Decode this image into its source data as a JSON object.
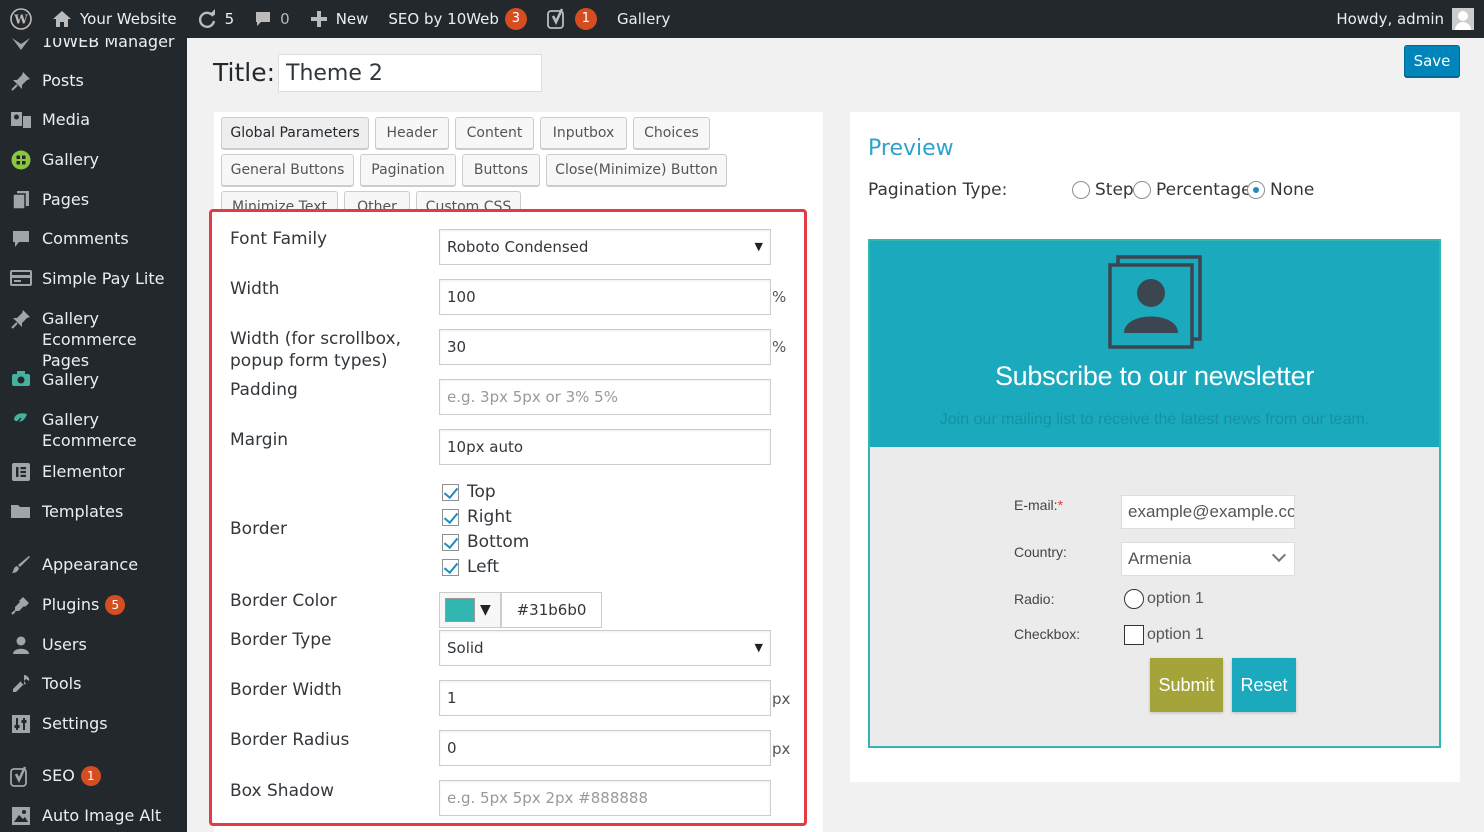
{
  "adminbar": {
    "site_name": "Your Website",
    "updates_count": "5",
    "comments_count": "0",
    "new_label": "New",
    "seo_label": "SEO by 10Web",
    "seo_count": "3",
    "yoast_count": "1",
    "gallery_label": "Gallery",
    "howdy": "Howdy, admin",
    "icons": [
      "wordpress-logo-icon",
      "home-icon",
      "refresh-icon",
      "comment-icon",
      "plus-icon",
      "yoast-icon"
    ]
  },
  "sidebar": {
    "items": [
      {
        "label": "10WEB Manager",
        "icon": "10web-icon"
      },
      {
        "label": "Posts",
        "icon": "pin-icon"
      },
      {
        "label": "Media",
        "icon": "media-icon"
      },
      {
        "label": "Gallery",
        "icon": "gallery-icon"
      },
      {
        "label": "Pages",
        "icon": "page-icon"
      },
      {
        "label": "Comments",
        "icon": "comment-icon"
      },
      {
        "label": "Simple Pay Lite",
        "icon": "pay-icon"
      },
      {
        "label": "Gallery Ecommerce Pages",
        "icon": "pin-icon"
      },
      {
        "label": "Gallery",
        "icon": "camera-icon"
      },
      {
        "label": "Gallery Ecommerce",
        "icon": "ecommerce-icon"
      },
      {
        "label": "Elementor",
        "icon": "elementor-icon"
      },
      {
        "label": "Templates",
        "icon": "folder-icon"
      },
      {
        "label": "Appearance",
        "icon": "brush-icon"
      },
      {
        "label": "Plugins",
        "icon": "plugin-icon",
        "badge": "5"
      },
      {
        "label": "Users",
        "icon": "user-icon"
      },
      {
        "label": "Tools",
        "icon": "wrench-icon"
      },
      {
        "label": "Settings",
        "icon": "settings-icon"
      },
      {
        "label": "SEO",
        "icon": "yoast-icon",
        "badge": "1"
      },
      {
        "label": "Auto Image Alt",
        "icon": "image-alt-icon"
      }
    ]
  },
  "title": {
    "label": "Title:",
    "value": "Theme 2",
    "save_label": "Save"
  },
  "tabs": [
    "Global Parameters",
    "Header",
    "Content",
    "Inputbox",
    "Choices",
    "General Buttons",
    "Pagination",
    "Buttons",
    "Close(Minimize) Button",
    "Minimize Text",
    "Other",
    "Custom CSS"
  ],
  "options": {
    "font_family": {
      "label": "Font Family",
      "value": "Roboto Condensed"
    },
    "width": {
      "label": "Width",
      "value": "100",
      "unit": "%"
    },
    "width_scroll": {
      "label": "Width (for scrollbox, popup form types)",
      "value": "30",
      "unit": "%"
    },
    "padding": {
      "label": "Padding",
      "placeholder": "e.g. 3px 5px or 3% 5%"
    },
    "margin": {
      "label": "Margin",
      "value": "10px auto"
    },
    "border": {
      "label": "Border",
      "top": "Top",
      "right": "Right",
      "bottom": "Bottom",
      "left": "Left"
    },
    "border_color": {
      "label": "Border Color",
      "value": "#31b6b0"
    },
    "border_type": {
      "label": "Border Type",
      "value": "Solid"
    },
    "border_width": {
      "label": "Border Width",
      "value": "1",
      "unit": "px"
    },
    "border_radius": {
      "label": "Border Radius",
      "value": "0",
      "unit": "px"
    },
    "box_shadow": {
      "label": "Box Shadow",
      "placeholder": "e.g. 5px 5px 2px #888888"
    }
  },
  "preview": {
    "title": "Preview",
    "pagination_label": "Pagination Type:",
    "pagination_options": [
      "Step",
      "Percentage",
      "None"
    ],
    "pagination_selected": "None",
    "form": {
      "heading": "Subscribe to our newsletter",
      "subheading": "Join our mailing list to receive the latest news from our team.",
      "email_label": "E-mail:",
      "required_mark": "*",
      "email_placeholder": "example@example.com",
      "country_label": "Country:",
      "country_value": "Armenia",
      "radio_label": "Radio:",
      "radio_option": "option 1",
      "checkbox_label": "Checkbox:",
      "checkbox_option": "option 1",
      "submit_label": "Submit",
      "reset_label": "Reset"
    }
  },
  "colors": {
    "adminbar_bg": "#23282d",
    "highlight": "#e33b43",
    "form_header": "#1ba9be",
    "form_border": "#31b6b0",
    "submit_bg": "#a5a43b",
    "save_bg": "#0085ba"
  }
}
